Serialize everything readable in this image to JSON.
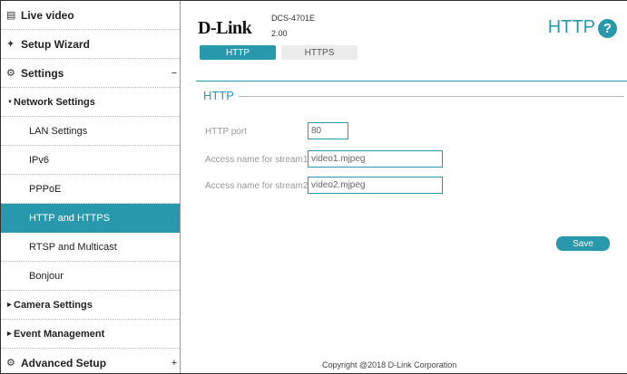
{
  "sidebar": {
    "live_video": {
      "label": "Live video",
      "icon": "video-icon"
    },
    "setup_wizard": {
      "label": "Setup Wizard",
      "icon": "wand-icon"
    },
    "settings": {
      "label": "Settings",
      "icon": "gear-icon",
      "toggle": "−"
    },
    "network_settings": {
      "label": "Network Settings"
    },
    "network_items": [
      {
        "label": "LAN Settings"
      },
      {
        "label": "IPv6"
      },
      {
        "label": "PPPoE"
      },
      {
        "label": "HTTP and HTTPS"
      },
      {
        "label": "RTSP and Multicast"
      },
      {
        "label": "Bonjour"
      }
    ],
    "camera_settings": {
      "label": "Camera Settings"
    },
    "event_management": {
      "label": "Event Management"
    },
    "advanced_setup": {
      "label": "Advanced Setup",
      "icon": "gears-icon",
      "toggle": "+"
    }
  },
  "header": {
    "logo": "D-Link",
    "model": "DCS-4701E",
    "version": "2.00",
    "page_title": "HTTP",
    "help_label": "?"
  },
  "tabs": [
    {
      "label": "HTTP",
      "active": true
    },
    {
      "label": "HTTPS",
      "active": false
    }
  ],
  "form": {
    "section_title": "HTTP",
    "http_port": {
      "label": "HTTP port",
      "value": "80"
    },
    "stream1": {
      "label": "Access name for stream1",
      "value": "video1.mjpeg"
    },
    "stream2": {
      "label": "Access name for stream2",
      "value": "video2.mjpeg"
    },
    "save_label": "Save"
  },
  "footer": {
    "copyright": "Copyright @2018 D-Link Corporation"
  },
  "colors": {
    "accent": "#2898ad"
  }
}
